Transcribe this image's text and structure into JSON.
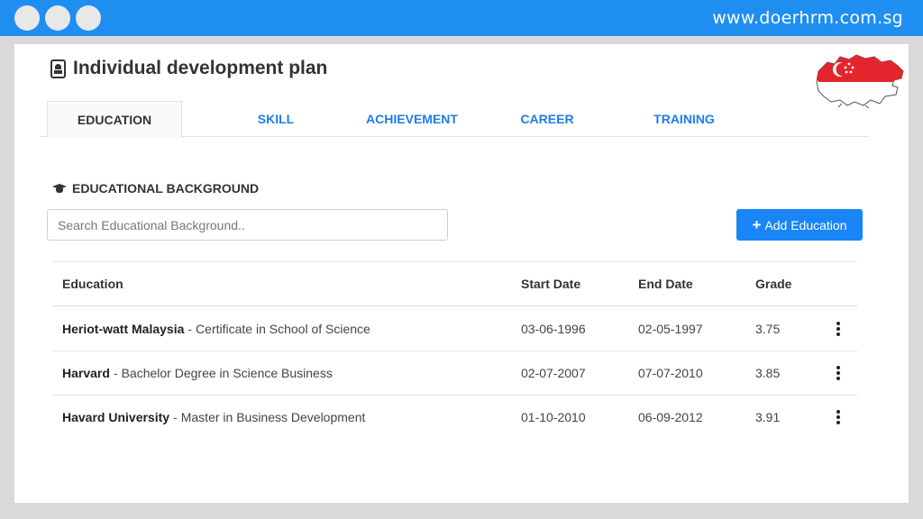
{
  "browser": {
    "url": "www.doerhrm.com.sg"
  },
  "page": {
    "title": "Individual development plan"
  },
  "tabs": [
    {
      "label": "EDUCATION",
      "active": true
    },
    {
      "label": "SKILL",
      "active": false
    },
    {
      "label": "ACHIEVEMENT",
      "active": false
    },
    {
      "label": "CAREER",
      "active": false
    },
    {
      "label": "TRAINING",
      "active": false
    }
  ],
  "section": {
    "title": "EDUCATIONAL BACKGROUND",
    "icon": "graduation-cap-icon"
  },
  "search": {
    "placeholder": "Search Educational Background..",
    "value": ""
  },
  "add_button": {
    "label": "Add Education",
    "icon": "plus-icon"
  },
  "table": {
    "headers": {
      "education": "Education",
      "start": "Start Date",
      "end": "End Date",
      "grade": "Grade"
    },
    "separator": "-",
    "rows": [
      {
        "institution": "Heriot-watt Malaysia",
        "program": "Certificate in School of Science",
        "start": "03-06-1996",
        "end": "02-05-1997",
        "grade": "3.75"
      },
      {
        "institution": "Harvard",
        "program": "Bachelor Degree in Science Business",
        "start": "02-07-2007",
        "end": "07-07-2010",
        "grade": "3.85"
      },
      {
        "institution": "Havard University",
        "program": "Master in Business Development",
        "start": "01-10-2010",
        "end": "06-09-2012",
        "grade": "3.91"
      }
    ]
  },
  "colors": {
    "accent": "#1f8ef1",
    "button": "#1a85f7",
    "flag_red": "#e3262e"
  }
}
